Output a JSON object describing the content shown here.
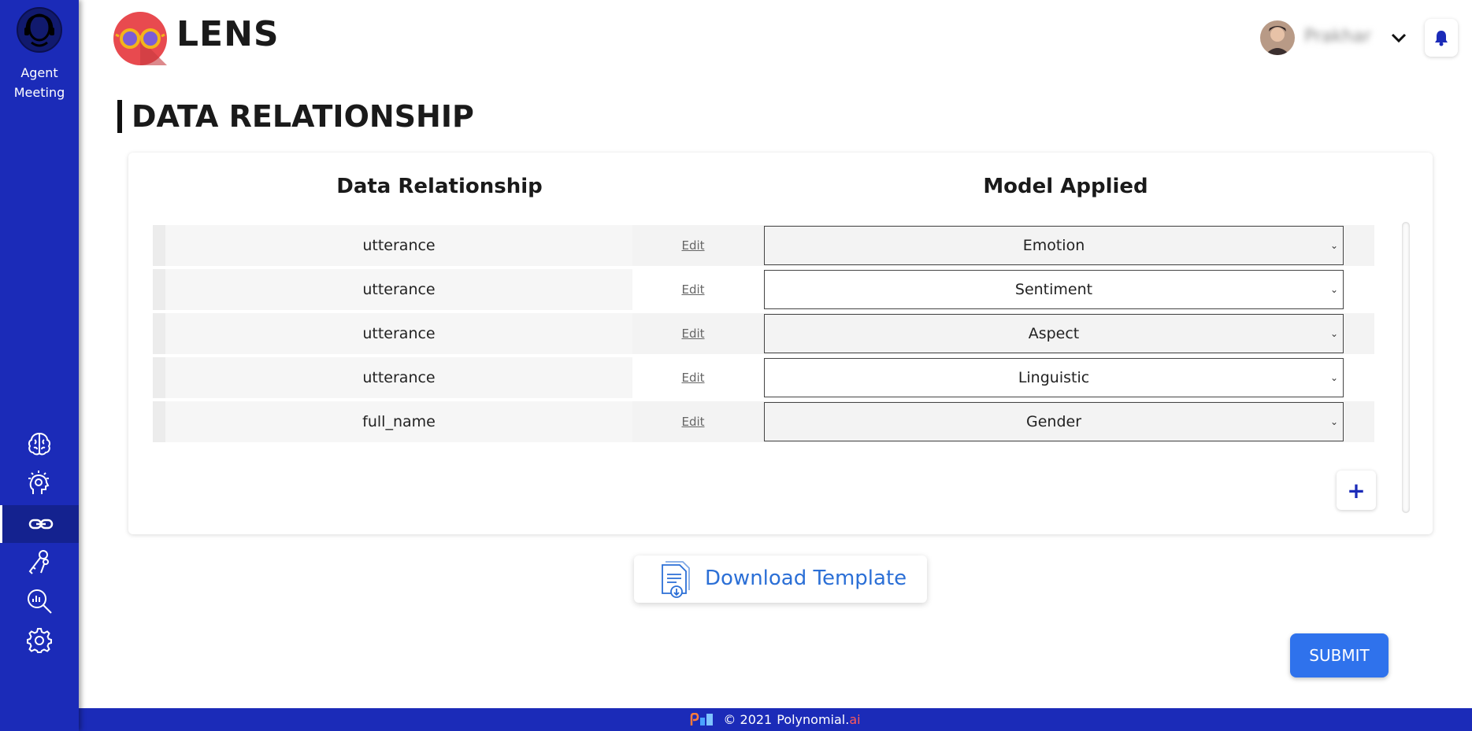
{
  "sidebar": {
    "title": "Agent Meeting",
    "items": [
      {
        "icon": "brain-icon",
        "active": false
      },
      {
        "icon": "head-idea-icon",
        "active": false
      },
      {
        "icon": "link-icon",
        "active": true
      },
      {
        "icon": "keys-icon",
        "active": false
      },
      {
        "icon": "analytics-search-icon",
        "active": false
      },
      {
        "icon": "gear-icon",
        "active": false
      }
    ]
  },
  "header": {
    "brand": "LENS",
    "user_name": "Prakhar"
  },
  "page": {
    "title": "DATA RELATIONSHIP"
  },
  "table": {
    "col_left": "Data Relationship",
    "col_right": "Model Applied",
    "rows": [
      {
        "field": "utterance",
        "edit": "Edit",
        "model": "Emotion"
      },
      {
        "field": "utterance",
        "edit": "Edit",
        "model": "Sentiment"
      },
      {
        "field": "utterance",
        "edit": "Edit",
        "model": "Aspect"
      },
      {
        "field": "utterance",
        "edit": "Edit",
        "model": "Linguistic"
      },
      {
        "field": "full_name",
        "edit": "Edit",
        "model": "Gender"
      }
    ],
    "add_label": "+"
  },
  "actions": {
    "download_label": "Download Template",
    "submit_label": "SUBMIT"
  },
  "footer": {
    "copyright": "© 2021",
    "company_main": "Polynomial.",
    "company_suffix": "ai"
  },
  "colors": {
    "sidebar": "#1b2bb8",
    "accent_blue": "#2f72ec",
    "link_blue": "#2b6fd6"
  }
}
